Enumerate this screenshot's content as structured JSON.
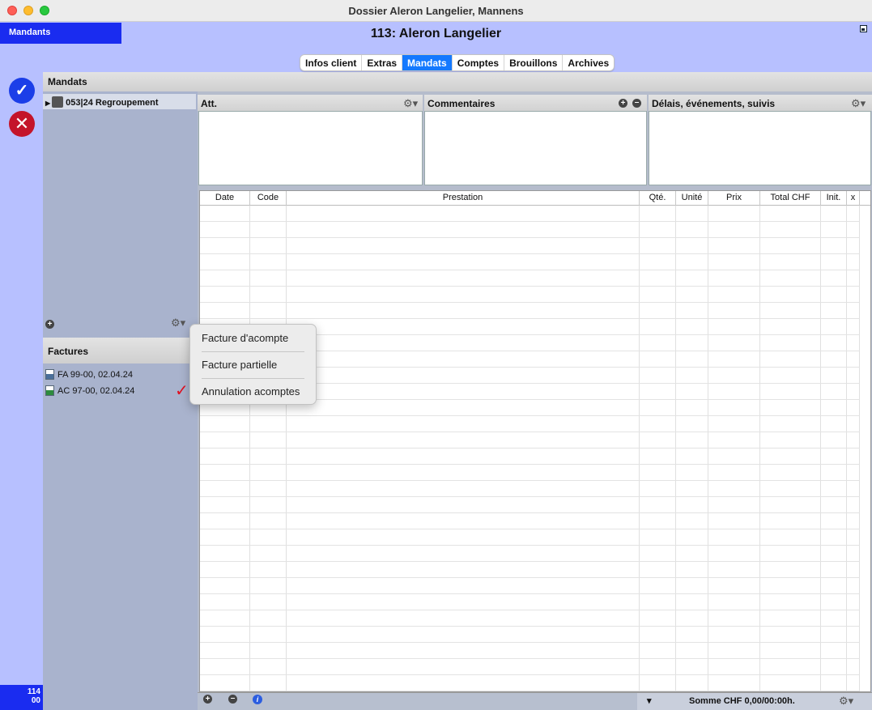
{
  "window": {
    "title": "Dossier Aleron Langelier, Mannens"
  },
  "header": {
    "sidebar_chip": "Mandants",
    "client_title": "113: Aleron Langelier"
  },
  "tabs": [
    {
      "label": "Infos client"
    },
    {
      "label": "Extras"
    },
    {
      "label": "Mandats",
      "active": true
    },
    {
      "label": "Comptes"
    },
    {
      "label": "Brouillons"
    },
    {
      "label": "Archives"
    }
  ],
  "mandats": {
    "heading": "Mandats",
    "items": [
      {
        "label": "053|24 Regroupement"
      }
    ]
  },
  "factures": {
    "heading": "Factures",
    "items": [
      {
        "label": "FA 99-00, 02.04.24",
        "icon": "blue-document-icon"
      },
      {
        "label": "AC 97-00, 02.04.24",
        "icon": "green-document-icon",
        "checked": true
      }
    ],
    "checkmark": "✓"
  },
  "panels": {
    "att": "Att.",
    "commentaires": "Commentaires",
    "delais": "Délais, événements, suivis"
  },
  "grid": {
    "columns": [
      "Date",
      "Code",
      "Prestation",
      "Qté.",
      "Unité",
      "Prix",
      "Total CHF",
      "Init.",
      "x"
    ]
  },
  "footer": {
    "summary": "Somme CHF 0,00/00:00h."
  },
  "popup_menu": {
    "items": [
      "Facture d'acompte",
      "Facture partielle",
      "Annulation acomptes"
    ]
  },
  "counter": {
    "line1": "114",
    "line2": "00"
  },
  "icons": {
    "ok": "✓",
    "cancel": "✕",
    "gear": "⚙▾",
    "plus": "+",
    "minus": "–",
    "info": "i",
    "dropdown": "▾",
    "triangle": "▶"
  },
  "colors": {
    "accent": "#1479ff",
    "sidebar_blue": "#1a2cf0",
    "ok": "#1b3ee8",
    "cancel": "#c4142a",
    "background": "#b7c0ff",
    "check": "#e01020"
  }
}
